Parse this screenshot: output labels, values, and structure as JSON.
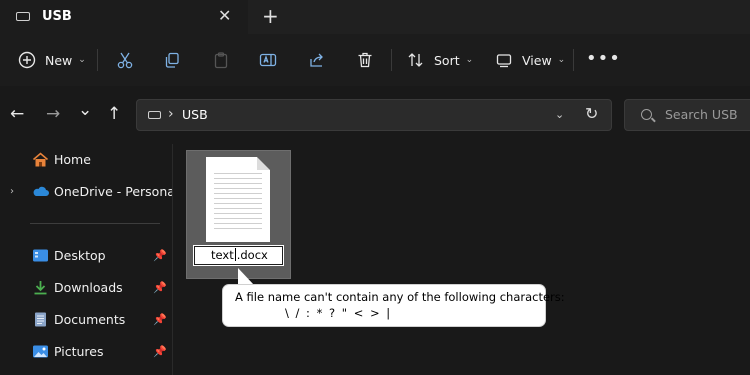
{
  "tab": {
    "title": "USB",
    "close_glyph": "✕",
    "new_tab_glyph": "+"
  },
  "toolbar": {
    "new_label": "New",
    "sort_label": "Sort",
    "view_label": "View",
    "more_glyph": "•••",
    "icons": [
      "cut-icon",
      "copy-icon",
      "paste-icon",
      "rename-icon",
      "share-icon",
      "delete-icon"
    ]
  },
  "nav": {
    "back": "←",
    "forward": "→",
    "recent": "⌄",
    "up": "↑"
  },
  "address": {
    "path": "USB",
    "separator": "›",
    "refresh_glyph": "↻",
    "dropdown_glyph": "⌄"
  },
  "search": {
    "placeholder": "Search USB"
  },
  "sidebar": {
    "items": [
      {
        "label": "Home",
        "pinned": false
      },
      {
        "label": "OneDrive - Personal",
        "pinned": false,
        "expandable": true
      },
      {
        "label": "Desktop",
        "pinned": true
      },
      {
        "label": "Downloads",
        "pinned": true
      },
      {
        "label": "Documents",
        "pinned": true
      },
      {
        "label": "Pictures",
        "pinned": true
      }
    ],
    "pin_glyph": "📌",
    "expand_glyph": "›"
  },
  "file": {
    "name_before_cursor": "text",
    "name_after_cursor": ".docx"
  },
  "tooltip": {
    "line1": "A file name can't contain any of the following characters:",
    "line2": "\\ / : * ? \" < > |"
  },
  "colors": {
    "background": "#191919",
    "chrome": "#202020",
    "selection": "#5c5c5c",
    "home_icon": "#e8833a",
    "onedrive_icon": "#2b88d8",
    "desktop_icon": "#3a8ee6",
    "downloads_icon": "#4caf50"
  }
}
